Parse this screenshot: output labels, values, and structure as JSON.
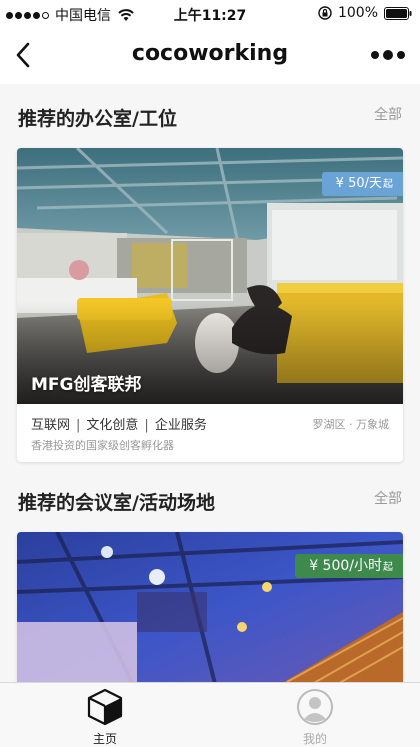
{
  "status_bar": {
    "carrier": "中国电信",
    "time": "上午11:27",
    "battery": "100%"
  },
  "nav": {
    "title": "cocoworking"
  },
  "sections": [
    {
      "title": "推荐的办公室/工位",
      "all_label": "全部",
      "card": {
        "name": "MFG创客联邦",
        "price": "¥ 50/天",
        "price_suffix": "起",
        "tags": [
          "互联网",
          "文化创意",
          "企业服务"
        ],
        "location": "罗湖区 · 万象城",
        "description": "香港投资的国家级创客孵化器"
      }
    },
    {
      "title": "推荐的会议室/活动场地",
      "all_label": "全部",
      "card": {
        "price": "¥ 500/小时",
        "price_suffix": "起"
      }
    }
  ],
  "tabbar": {
    "items": [
      {
        "label": "主页",
        "icon": "cube-icon",
        "active": true
      },
      {
        "label": "我的",
        "icon": "user-avatar-icon",
        "active": false
      }
    ]
  }
}
